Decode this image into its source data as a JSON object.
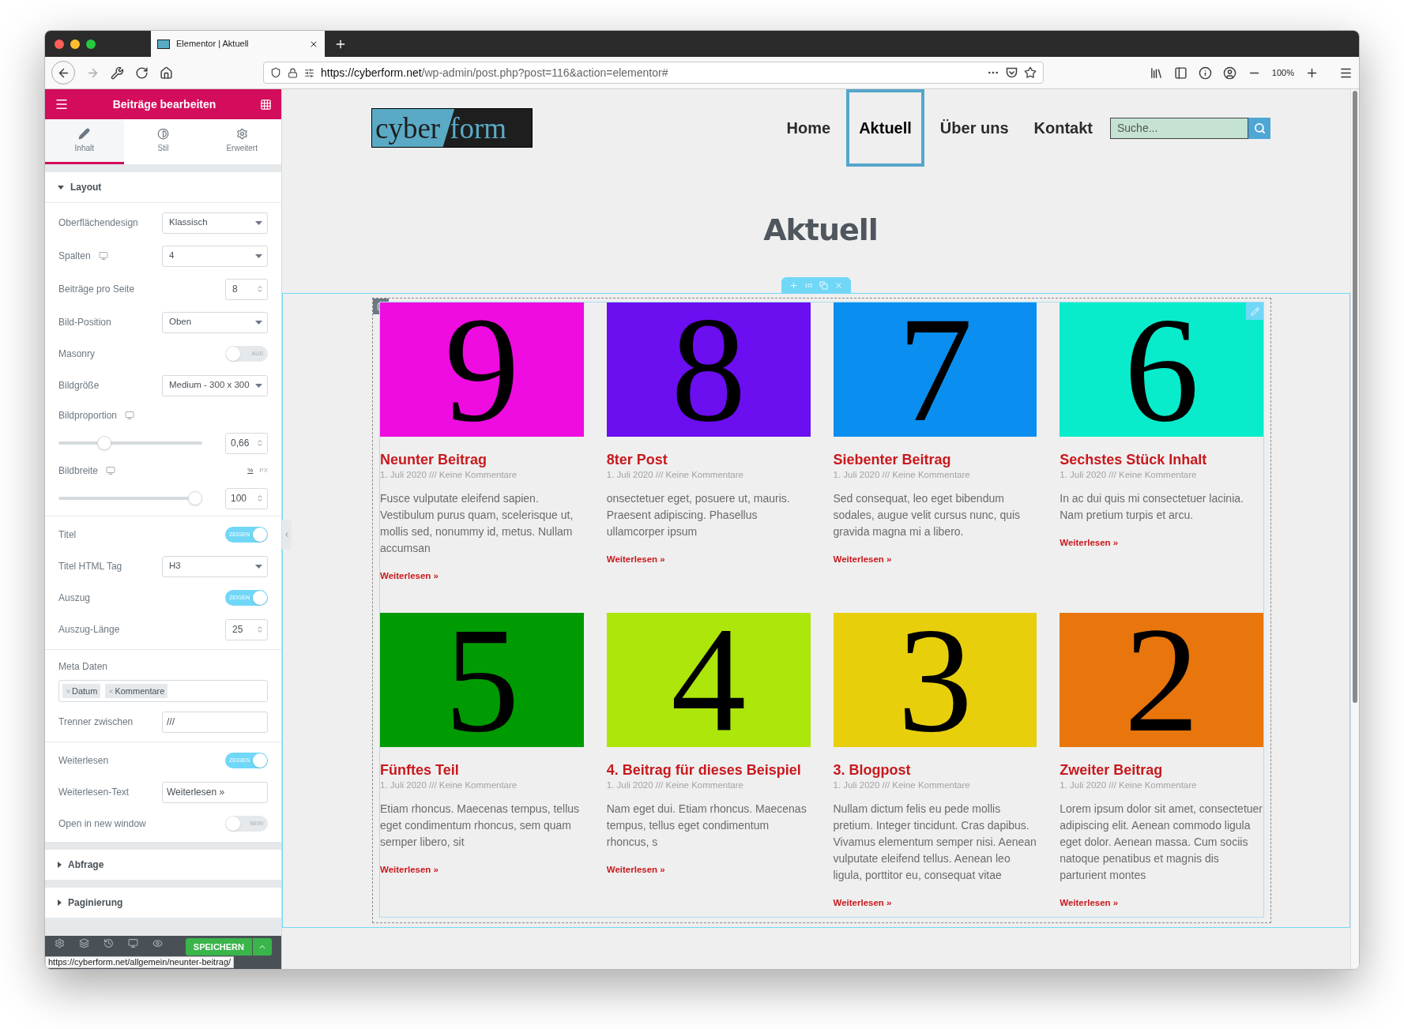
{
  "browser": {
    "tab_title": "Elementor | Aktuell",
    "url_host": "https://cyberform.net",
    "url_path": "/wp-admin/post.php?post=116&action=elementor#",
    "zoom": "100%",
    "status_url": "https://cyberform.net/allgemein/neunter-beitrag/"
  },
  "editor": {
    "title": "Beiträge bearbeiten",
    "tabs": [
      {
        "label": "Inhalt",
        "selected": true
      },
      {
        "label": "Stil",
        "selected": false
      },
      {
        "label": "Erweitert",
        "selected": false
      }
    ],
    "sections": [
      {
        "title": "Layout",
        "expanded": true,
        "groups": [
          [
            {
              "kind": "select",
              "label": "Oberflächendesign",
              "value": "Klassisch"
            },
            {
              "kind": "select",
              "label": "Spalten",
              "value": "4",
              "responsive": true
            },
            {
              "kind": "number",
              "label": "Beiträge pro Seite",
              "value": "8"
            },
            {
              "kind": "select",
              "label": "Bild-Position",
              "value": "Oben"
            },
            {
              "kind": "toggle",
              "label": "Masonry",
              "on": false,
              "state_label": "AUS"
            },
            {
              "kind": "select",
              "label": "Bildgröße",
              "value": "Medium - 300 x 300"
            },
            {
              "kind": "slider",
              "label": "Bildproportion",
              "responsive": true,
              "level": 0.3,
              "value": "0,66"
            },
            {
              "kind": "slider",
              "label": "Bildbreite",
              "responsive": true,
              "level": 1,
              "value": "100",
              "units": [
                {
                  "label": "%",
                  "selected": true
                },
                {
                  "label": "PX",
                  "selected": false
                }
              ]
            }
          ],
          [
            {
              "kind": "toggle",
              "label": "Titel",
              "on": true,
              "state_label": "ZEIGEN"
            },
            {
              "kind": "select",
              "label": "Titel HTML Tag",
              "value": "H3"
            },
            {
              "kind": "toggle",
              "label": "Auszug",
              "on": true,
              "state_label": "ZEIGEN"
            },
            {
              "kind": "number",
              "label": "Auszug-Länge",
              "value": "25"
            }
          ],
          [
            {
              "kind": "tags",
              "label": "Meta Daten",
              "tags": [
                "Datum",
                "Kommentare"
              ]
            },
            {
              "kind": "text",
              "label": "Trenner zwischen",
              "value": "///"
            }
          ],
          [
            {
              "kind": "toggle",
              "label": "Weiterlesen",
              "on": true,
              "state_label": "ZEIGEN"
            },
            {
              "kind": "text",
              "label": "Weiterlesen-Text",
              "value": "Weiterlesen »"
            },
            {
              "kind": "toggle",
              "label": "Open in new window",
              "on": false,
              "state_label": "NEIN"
            }
          ]
        ]
      },
      {
        "title": "Abfrage",
        "expanded": false
      },
      {
        "title": "Paginierung",
        "expanded": false
      }
    ],
    "save_button": "SPEICHERN"
  },
  "site": {
    "logo": {
      "left": "cyber",
      "right": "form"
    },
    "nav": [
      {
        "label": "Home",
        "selected": false
      },
      {
        "label": "Aktuell",
        "selected": true
      },
      {
        "label": "Über uns",
        "selected": false
      },
      {
        "label": "Kontakt",
        "selected": false
      }
    ],
    "search": {
      "placeholder": "Suche..."
    },
    "page_title": "Aktuell",
    "posts": [
      {
        "image_label": "9",
        "color": "#ef0ce0",
        "title": "Neunter Beitrag",
        "meta": "1. Juli 2020 /// Keine Kommentare",
        "excerpt": "Fusce vulputate eleifend sapien. Vestibulum purus quam, scelerisque ut, mollis sed, nonummy id, metus. Nullam accumsan",
        "read_more": "Weiterlesen »"
      },
      {
        "image_label": "8",
        "color": "#6b0ef0",
        "title": "8ter Post",
        "meta": "1. Juli 2020 /// Keine Kommentare",
        "excerpt": "onsectetuer eget, posuere ut, mauris. Praesent adipiscing. Phasellus ullamcorper ipsum",
        "read_more": "Weiterlesen »"
      },
      {
        "image_label": "7",
        "color": "#0a8ef0",
        "title": "Siebenter Beitrag",
        "meta": "1. Juli 2020 /// Keine Kommentare",
        "excerpt": "Sed consequat, leo eget bibendum sodales, augue velit cursus nunc, quis gravida magna mi a libero.",
        "read_more": "Weiterlesen »"
      },
      {
        "image_label": "6",
        "color": "#08eccb",
        "title": "Sechstes Stück Inhalt",
        "meta": "1. Juli 2020 /// Keine Kommentare",
        "excerpt": "In ac dui quis mi consectetuer lacinia. Nam pretium turpis et arcu.",
        "read_more": "Weiterlesen »"
      },
      {
        "image_label": "5",
        "color": "#009a03",
        "title": "Fünftes Teil",
        "meta": "1. Juli 2020 /// Keine Kommentare",
        "excerpt": "Etiam rhoncus. Maecenas tempus, tellus eget condimentum rhoncus, sem quam semper libero, sit",
        "read_more": "Weiterlesen »"
      },
      {
        "image_label": "4",
        "color": "#ace60b",
        "title": "4. Beitrag für dieses Beispiel",
        "meta": "1. Juli 2020 /// Keine Kommentare",
        "excerpt": "Nam eget dui. Etiam rhoncus. Maecenas tempus, tellus eget condimentum rhoncus, s",
        "read_more": "Weiterlesen »"
      },
      {
        "image_label": "3",
        "color": "#e8cf0c",
        "title": "3. Blogpost",
        "meta": "1. Juli 2020 /// Keine Kommentare",
        "excerpt": "Nullam dictum felis eu pede mollis pretium. Integer tincidunt. Cras dapibus. Vivamus elementum semper nisi. Aenean vulputate eleifend tellus. Aenean leo ligula, porttitor eu, consequat vitae",
        "read_more": "Weiterlesen »"
      },
      {
        "image_label": "2",
        "color": "#e8760c",
        "title": "Zweiter Beitrag",
        "meta": "1. Juli 2020 /// Keine Kommentare",
        "excerpt": "Lorem ipsum dolor sit amet, consectetuer adipiscing elit. Aenean commodo ligula eget dolor. Aenean massa. Cum sociis natoque penatibus et magnis dis parturient montes",
        "read_more": "Weiterlesen »"
      }
    ]
  }
}
